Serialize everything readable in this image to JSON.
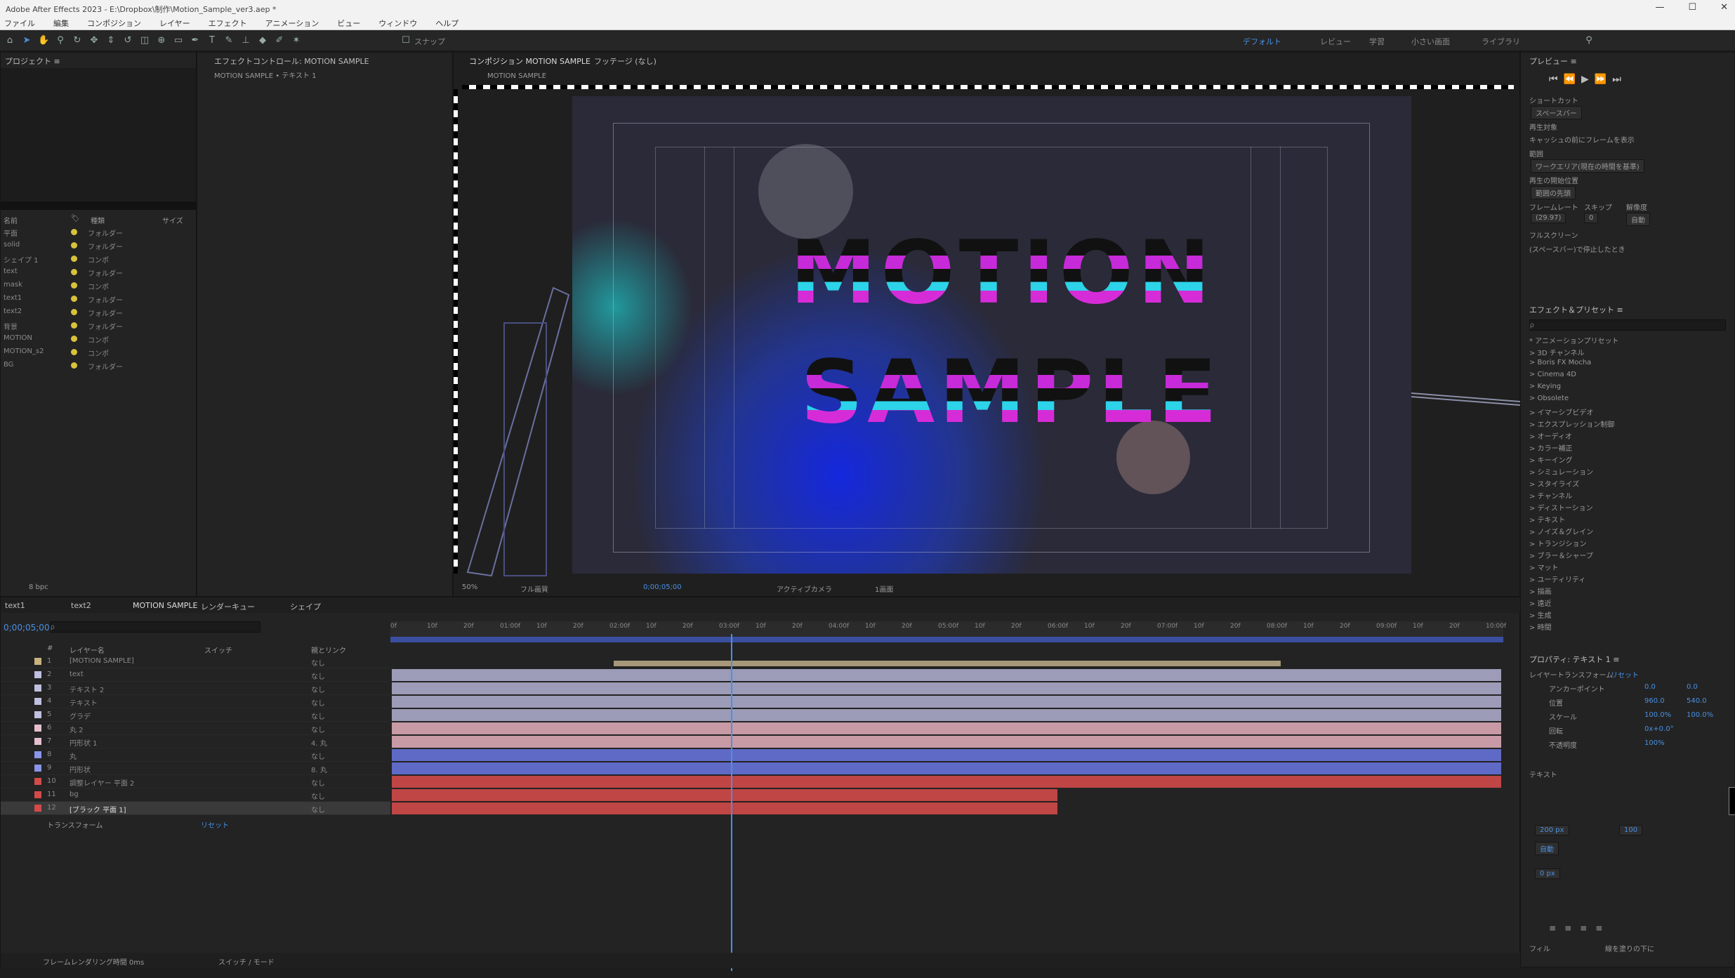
{
  "window": {
    "title": "Adobe After Effects 2023 - E:\\Dropbox\\制作\\Motion_Sample_ver3.aep *",
    "buttons": [
      "—",
      "☐",
      "✕"
    ]
  },
  "menu": [
    "ファイル",
    "編集",
    "コンポジション",
    "レイヤー",
    "エフェクト",
    "アニメーション",
    "ビュー",
    "ウィンドウ",
    "ヘルプ"
  ],
  "toolbar": {
    "snap_label": "スナップ",
    "workspaces": [
      "デフォルト",
      "レビュー",
      "学習",
      "小さい画面",
      "ライブラリ"
    ]
  },
  "project": {
    "tab": "プロジェクト ≡",
    "columns": {
      "name": "名前",
      "label": "🏷",
      "type": "種類",
      "size": "サイズ"
    },
    "items": [
      {
        "name": "平面",
        "type": "フォルダー",
        "size": ""
      },
      {
        "name": "solid",
        "type": "フォルダー",
        "size": ""
      },
      {
        "name": "シェイプ 1",
        "type": "コンポ",
        "size": ""
      },
      {
        "name": "text",
        "type": "フォルダー",
        "size": ""
      },
      {
        "name": "mask",
        "type": "コンポ",
        "size": ""
      },
      {
        "name": "text1",
        "type": "フォルダー",
        "size": ""
      },
      {
        "name": "text2",
        "type": "フォルダー",
        "size": ""
      },
      {
        "name": "背景",
        "type": "フォルダー",
        "size": ""
      },
      {
        "name": "MOTION",
        "type": "コンポ",
        "size": ""
      },
      {
        "name": "MOTION_s2",
        "type": "コンポ",
        "size": ""
      },
      {
        "name": "BG",
        "type": "フォルダー",
        "size": ""
      }
    ],
    "footer": "8 bpc"
  },
  "effects_panel": {
    "tab": "エフェクトコントロール: MOTION SAMPLE",
    "subtitle": "MOTION SAMPLE • テキスト 1"
  },
  "viewer": {
    "tabs": [
      "コンポジション MOTION SAMPLE",
      "フッテージ (なし)"
    ],
    "subtab": "MOTION SAMPLE",
    "line1": "MOTION",
    "line2": "SAMPLE",
    "zoom": "50%",
    "quality": "フル画質",
    "timecode": "0;00;05;00",
    "camera": "アクティブカメラ",
    "views": "1画面"
  },
  "timeline": {
    "tabs": [
      "text1",
      "text2",
      "MOTION SAMPLE",
      "レンダーキュー",
      "シェイプ"
    ],
    "timecode": "0;00;05;00",
    "search_placeholder": "ρ",
    "columns": {
      "label": "#",
      "name": "レイヤー名",
      "switches": "スイッチ",
      "mode": "モード",
      "parent": "親とリンク"
    },
    "layers": [
      {
        "num": "1",
        "name": "[MOTION SAMPLE]",
        "mode": "なし",
        "color": "#c9b27d"
      },
      {
        "num": "2",
        "name": "text",
        "mode": "なし",
        "color": "#bfbfe0"
      },
      {
        "num": "3",
        "name": "テキスト 2",
        "mode": "なし",
        "color": "#bfbfe0"
      },
      {
        "num": "4",
        "name": "テキスト",
        "mode": "なし",
        "color": "#bfbfe0"
      },
      {
        "num": "5",
        "name": "グラデ",
        "mode": "なし",
        "color": "#bfbfe0"
      },
      {
        "num": "6",
        "name": "丸 2",
        "mode": "なし",
        "color": "#e5bfcf"
      },
      {
        "num": "7",
        "name": "円形状 1",
        "mode": "4. 丸",
        "color": "#e5bfcf"
      },
      {
        "num": "8",
        "name": "丸",
        "mode": "なし",
        "color": "#8a94e8"
      },
      {
        "num": "9",
        "name": "円形状",
        "mode": "8. 丸",
        "color": "#8a94e8"
      },
      {
        "num": "10",
        "name": "調整レイヤー 平面 2",
        "mode": "なし",
        "color": "#d24a4a"
      },
      {
        "num": "11",
        "name": "bg",
        "mode": "なし",
        "color": "#d24a4a"
      },
      {
        "num": "12",
        "name": "[ブラック 平面 1]",
        "mode": "なし",
        "color": "#d24a4a"
      }
    ],
    "transform_label": "トランスフォーム",
    "transform_action": "リセット",
    "ruler_ticks": [
      "0f",
      "10f",
      "20f",
      "01:00f",
      "10f",
      "20f",
      "02:00f",
      "10f",
      "20f",
      "03:00f",
      "10f",
      "20f",
      "04:00f",
      "10f",
      "20f",
      "05:00f",
      "10f",
      "20f",
      "06:00f",
      "10f",
      "20f",
      "07:00f",
      "10f",
      "20f",
      "08:00f",
      "10f",
      "20f",
      "09:00f",
      "10f",
      "20f",
      "10:00f"
    ],
    "footer_left": "フレームレンダリング時間 0ms",
    "footer_mid": "スイッチ / モード"
  },
  "right": {
    "preview_tab": "プレビュー ≡",
    "shortcut_label": "ショートカット",
    "shortcut_value": "スペースバー",
    "include_label": "再生対象",
    "cache_label": "キャッシュの前にフレームを表示",
    "range_label": "範囲",
    "range_value": "ワークエリア(現在の時間を基準)",
    "play_from_label": "再生の開始位置",
    "play_from_value": "範囲の先頭",
    "fps_label": "フレームレート",
    "skip_label": "スキップ",
    "resolution_label": "解像度",
    "fps_value": "(29.97)",
    "skip_value": "0",
    "res_value": "自動",
    "fullscreen": "フルスクリーン",
    "stop_label": "(スペースバー)で停止したとき",
    "effects_tab": "エフェクト＆プリセット ≡",
    "effects_search": "ρ",
    "categories": [
      "* アニメーションプリセット",
      "> 3D チャンネル",
      "> Boris FX Mocha",
      "> Cinema 4D",
      "> Keying",
      "> Obsolete",
      "> イマーシブビデオ",
      "> エクスプレッション制御",
      "> オーディオ",
      "> カラー補正",
      "> キーイング",
      "> シミュレーション",
      "> スタイライズ",
      "> チャンネル",
      "> ディストーション",
      "> テキスト",
      "> ノイズ＆グレイン",
      "> トランジション",
      "> ブラー＆シャープ",
      "> マット",
      "> ユーティリティ",
      "> 描画",
      "> 遠近",
      "> 生成",
      "> 時間"
    ],
    "props_tab": "プロパティ: テキスト 1 ≡",
    "props": [
      {
        "label": "アンカーポイント",
        "v1": "0.0",
        "v2": "0.0"
      },
      {
        "label": "位置",
        "v1": "960.0",
        "v2": "540.0"
      },
      {
        "label": "スケール",
        "v1": "100.0%",
        "v2": "100.0%"
      },
      {
        "label": "回転",
        "v1": "0x+0.0°",
        "v2": ""
      },
      {
        "label": "不透明度",
        "v1": "100%",
        "v2": ""
      }
    ],
    "transform_label": "レイヤートランスフォーム",
    "reset_label": "リセット",
    "text_section": "テキスト",
    "font_size": "200 px",
    "tracking": "100",
    "leading": "自動",
    "stroke": "0 px",
    "align_left": "左揃え",
    "align_center": "中央揃え",
    "bottom_left": "フィル",
    "bottom_right": "線を塗りの下に"
  }
}
